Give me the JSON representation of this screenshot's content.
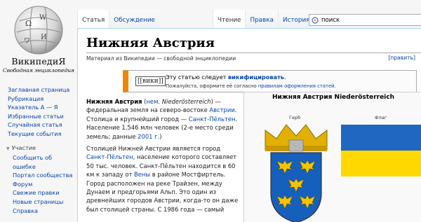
{
  "logo": {
    "wordmark": "ВикипедиЯ",
    "tagline": "Свободная энциклопедия"
  },
  "nav": {
    "main": [
      {
        "label": "Заглавная страница"
      },
      {
        "label": "Рубрикация"
      },
      {
        "label": "Указатель А — Я"
      },
      {
        "label": "Избранные статьи"
      },
      {
        "label": "Случайная статья"
      },
      {
        "label": "Текущие события"
      }
    ],
    "participation_title": "Участие",
    "participation": [
      {
        "label": "Сообщить об"
      },
      {
        "label": "ошибке"
      },
      {
        "label": "Портал сообщества"
      },
      {
        "label": "Форум"
      },
      {
        "label": "Свежие правки"
      },
      {
        "label": "Новые страницы"
      },
      {
        "label": "Справка"
      }
    ]
  },
  "tabs": {
    "article": "Статья",
    "discussion": "Обсуждение",
    "read": "Чтение",
    "edit": "Правка",
    "history": "История"
  },
  "search": {
    "value": "поиск"
  },
  "page": {
    "title": "Нижняя Австрия",
    "site_sub": "Материал из Википедии — свободной энциклопедии",
    "edit_link": "[править]"
  },
  "ambox": {
    "tag": "[[вики]]",
    "msg_prefix": "Эту статью следует ",
    "msg_link": "викифицировать",
    "msg_suffix": ".",
    "hint_prefix": "Пожалуйста, оформите её согласно ",
    "hint_link": "правилам оформления статей",
    "hint_suffix": "."
  },
  "article": {
    "p1": {
      "bold": "Нижняя Австрия",
      "t1": " (",
      "link1": "нем.",
      "t2": " ",
      "italic": "Niederösterreich",
      "t3": ") — федеральная земля на северо-востоке ",
      "link2": "Австрии",
      "t4": ". Столица и крупнейший город — ",
      "link3": "Санкт-Пёльтен",
      "t5": ". Население 1,546 млн человек (2-е место среди земель; данные ",
      "link4": "2001 г.",
      "t6": ")"
    },
    "p2": {
      "t1": "Столицей Нижней Австрии является город ",
      "link1": "Санкт-Пёльтен",
      "t2": ", население которого составляет 50 тыс. человек. Санкт-Пёльтен находится в 60 км к западу от ",
      "link2": "Вены",
      "t3": " в районе Мостфиртель. Город расположен на реке Трайзен, между Дунаем и предгорьями Альп. Это один из древнейших городов Австрии, когда-то он даже был столицей страны. С 1986 года — самый"
    }
  },
  "infobox": {
    "title": "Нижняя Австрия Niederösterreich",
    "coat_caption": "Герб",
    "flag_caption": "Флаг",
    "colors": {
      "flag_top": "#1f67c0",
      "flag_bottom": "#ffd800",
      "shield": "#1560bd",
      "eagle": "#f5c400",
      "crown": "#e2b000"
    }
  }
}
